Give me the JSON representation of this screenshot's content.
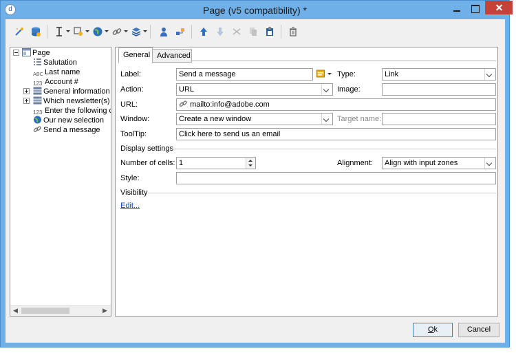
{
  "window": {
    "title": "Page (v5 compatibility) *",
    "app_icon_glyph": "d"
  },
  "toolbar": {
    "icons": [
      "wand-icon",
      "database-icon",
      "insert-field-icon",
      "insert-object-icon",
      "web-icon",
      "link-icon",
      "layers-icon",
      "user-icon",
      "workflow-icon",
      "move-up-icon",
      "move-down-icon",
      "cut-icon",
      "copy-icon",
      "paste-icon",
      "delete-icon"
    ]
  },
  "tree": {
    "root": "Page",
    "items": [
      {
        "label": "Salutation",
        "icon": "list-icon"
      },
      {
        "label": "Last name",
        "icon": "text-abc-icon",
        "glyph": "ABC"
      },
      {
        "label": "Account #",
        "icon": "number-123-icon",
        "glyph": "123"
      },
      {
        "label": "General information",
        "icon": "container-icon"
      },
      {
        "label": "Which newsletter(s) d",
        "icon": "container-icon"
      },
      {
        "label": "Enter the following ch",
        "icon": "number-123-icon",
        "glyph": "123"
      },
      {
        "label": "Our new selection",
        "icon": "globe-icon"
      },
      {
        "label": "Send a message",
        "icon": "link-icon"
      }
    ]
  },
  "tabs": [
    {
      "label": "General",
      "active": true
    },
    {
      "label": "Advanced",
      "active": false
    }
  ],
  "form": {
    "label": {
      "caption": "Label:",
      "value": "Send a message"
    },
    "type": {
      "caption": "Type:",
      "value": "Link"
    },
    "action": {
      "caption": "Action:",
      "value": "URL"
    },
    "image": {
      "caption": "Image:",
      "value": ""
    },
    "url": {
      "caption": "URL:",
      "value": "mailto:info@adobe.com"
    },
    "window": {
      "caption": "Window:",
      "value": "Create a new window"
    },
    "target_name": {
      "caption": "Target name:",
      "value": ""
    },
    "tooltip": {
      "caption": "ToolTip:",
      "value": "Click here to send us an email"
    },
    "display_settings": "Display settings",
    "cells": {
      "caption": "Number of cells:",
      "value": "1"
    },
    "alignment": {
      "caption": "Alignment:",
      "value": "Align with input zones"
    },
    "style": {
      "caption": "Style:",
      "value": ""
    },
    "visibility": "Visibility",
    "edit_link": "Edit..."
  },
  "buttons": {
    "ok": {
      "accel": "O",
      "rest": "k"
    },
    "cancel": "Cancel"
  },
  "colors": {
    "title_bar": "#6fb0e8",
    "close_button": "#c7403a",
    "link": "#0645c2"
  }
}
